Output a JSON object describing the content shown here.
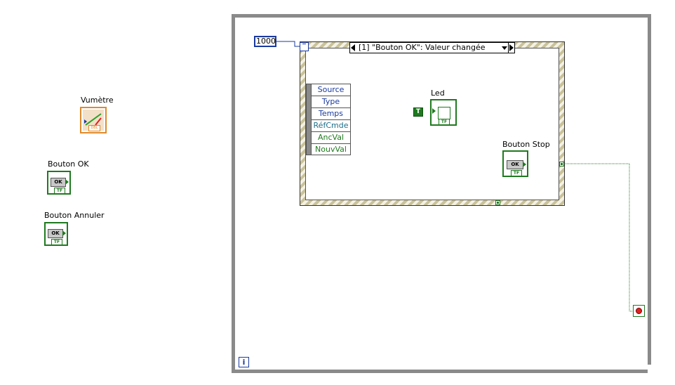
{
  "controls": {
    "vumetre_label": "Vumètre",
    "vumetre_type": "DBL",
    "bouton_ok_label": "Bouton OK",
    "bouton_annuler_label": "Bouton Annuler",
    "ok_text": "OK",
    "tf_text": "TF"
  },
  "diagram": {
    "timeout_constant": "1000",
    "event_case": "[1] \"Bouton OK\": Valeur changée",
    "event_data": [
      "Source",
      "Type",
      "Temps",
      "RéfCmde",
      "AncVal",
      "NouvVal"
    ],
    "led_label": "Led",
    "true_constant": "T",
    "bouton_stop_label": "Bouton Stop",
    "iteration_terminal": "i"
  },
  "colors": {
    "boolean_wire": "#1f7a1f",
    "numeric_i32": "#1a3aa0",
    "dbl_orange": "#e08a2a",
    "loop_border": "#8a8a8a",
    "event_blue_text": "#1a3aa0",
    "event_green_text": "#1f7a1f",
    "event_teal_text": "#1f6f8a"
  }
}
